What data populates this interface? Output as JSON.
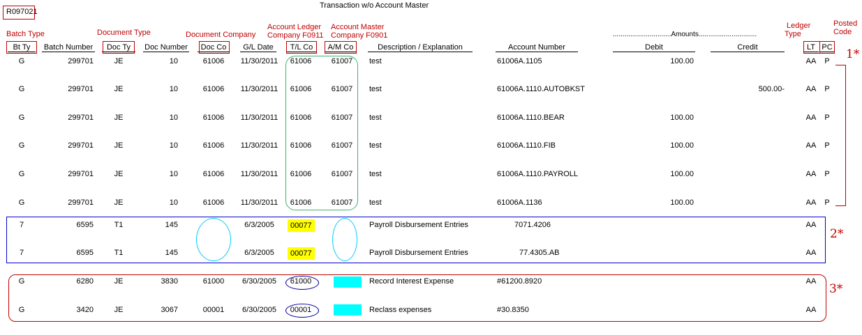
{
  "report_id": "R097021",
  "title": "Transaction w/o Account Master",
  "annotations": {
    "batch_type": "Batch Type",
    "document_type": "Document Type",
    "document_company": "Document Company",
    "acct_ledger_1": "Account Ledger",
    "acct_ledger_2": "Company F0911",
    "acct_master_1": "Account Master",
    "acct_master_2": "Company F0901",
    "ledger_type_1": "Ledger",
    "ledger_type_2": "Type",
    "posted_code_1": "Posted",
    "posted_code_2": "Code"
  },
  "amounts_header": "..............................Amounts..............................",
  "columns": {
    "bt_ty": "Bt Ty",
    "batch_number": "Batch Number",
    "doc_ty": "Doc Ty",
    "doc_number": "Doc Number",
    "doc_co": "Doc Co",
    "gl_date": "G/L Date",
    "tl_co": "T/L Co",
    "am_co": "A/M Co",
    "description": "Description / Explanation",
    "account_number": "Account Number",
    "debit": "Debit",
    "credit": "Credit",
    "lt": "LT",
    "pc": "PC"
  },
  "notes": [
    "1*",
    "2*",
    "3*"
  ],
  "rows": [
    {
      "bt": "G",
      "batch": "299701",
      "dt": "JE",
      "docnum": "10",
      "docco": "61006",
      "gl": "11/30/2011",
      "tl": "61006",
      "am": "61007",
      "desc": "test",
      "acct": "61006A.1105",
      "debit": "100.00",
      "credit": "",
      "lt": "AA",
      "pc": "P"
    },
    {
      "bt": "G",
      "batch": "299701",
      "dt": "JE",
      "docnum": "10",
      "docco": "61006",
      "gl": "11/30/2011",
      "tl": "61006",
      "am": "61007",
      "desc": "test",
      "acct": "61006A.1110.AUTOBKST",
      "debit": "",
      "credit": "500.00-",
      "lt": "AA",
      "pc": "P"
    },
    {
      "bt": "G",
      "batch": "299701",
      "dt": "JE",
      "docnum": "10",
      "docco": "61006",
      "gl": "11/30/2011",
      "tl": "61006",
      "am": "61007",
      "desc": "test",
      "acct": "61006A.1110.BEAR",
      "debit": "100.00",
      "credit": "",
      "lt": "AA",
      "pc": "P"
    },
    {
      "bt": "G",
      "batch": "299701",
      "dt": "JE",
      "docnum": "10",
      "docco": "61006",
      "gl": "11/30/2011",
      "tl": "61006",
      "am": "61007",
      "desc": "test",
      "acct": "61006A.1110.FIB",
      "debit": "100.00",
      "credit": "",
      "lt": "AA",
      "pc": "P"
    },
    {
      "bt": "G",
      "batch": "299701",
      "dt": "JE",
      "docnum": "10",
      "docco": "61006",
      "gl": "11/30/2011",
      "tl": "61006",
      "am": "61007",
      "desc": "test",
      "acct": "61006A.1110.PAYROLL",
      "debit": "100.00",
      "credit": "",
      "lt": "AA",
      "pc": "P"
    },
    {
      "bt": "G",
      "batch": "299701",
      "dt": "JE",
      "docnum": "10",
      "docco": "61006",
      "gl": "11/30/2011",
      "tl": "61006",
      "am": "61007",
      "desc": "test",
      "acct": "61006A.1136",
      "debit": "100.00",
      "credit": "",
      "lt": "AA",
      "pc": "P"
    },
    {
      "bt": "7",
      "batch": "6595",
      "dt": "T1",
      "docnum": "145",
      "docco": "",
      "gl": "6/3/2005",
      "tl": "00077",
      "am": "",
      "desc": "Payroll Disbursement Entries",
      "acct": "7071.4206",
      "debit": "",
      "credit": "",
      "lt": "AA",
      "pc": ""
    },
    {
      "bt": "7",
      "batch": "6595",
      "dt": "T1",
      "docnum": "145",
      "docco": "",
      "gl": "6/3/2005",
      "tl": "00077",
      "am": "",
      "desc": "Payroll Disbursement Entries",
      "acct": "77.4305.AB",
      "debit": "",
      "credit": "",
      "lt": "AA",
      "pc": ""
    },
    {
      "bt": "G",
      "batch": "6280",
      "dt": "JE",
      "docnum": "3830",
      "docco": "61000",
      "gl": "6/30/2005",
      "tl": "61000",
      "am": "",
      "desc": "Record Interest Expense",
      "acct": "#61200.8920",
      "debit": "",
      "credit": "",
      "lt": "AA",
      "pc": ""
    },
    {
      "bt": "G",
      "batch": "3420",
      "dt": "JE",
      "docnum": "3067",
      "docco": "00001",
      "gl": "6/30/2005",
      "tl": "00001",
      "am": "",
      "desc": "Reclass expenses",
      "acct": "#30.8350",
      "debit": "",
      "credit": "",
      "lt": "AA",
      "pc": ""
    }
  ]
}
